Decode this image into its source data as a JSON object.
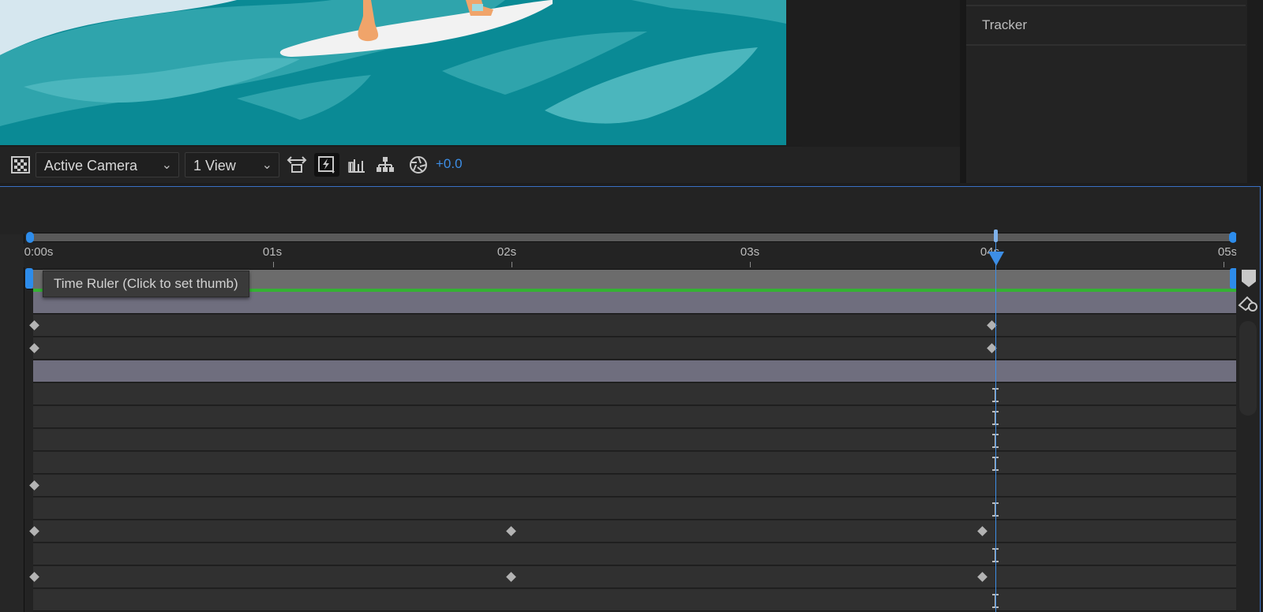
{
  "right_panel": {
    "tracker_label": "Tracker"
  },
  "viewer_toolbar": {
    "camera_dropdown": "Active Camera",
    "view_dropdown": "1 View",
    "exposure_value": "+0.0",
    "icons": [
      "transparency-grid-icon",
      "toggle-3d-icon",
      "fast-preview-icon",
      "draft-3d-icon",
      "flowchart-icon",
      "reset-exposure-icon"
    ]
  },
  "timeline": {
    "ruler_labels": [
      "0:00s",
      "01s",
      "02s",
      "03s",
      "04s",
      "05s"
    ],
    "tooltip": "Time Ruler (Click to set thumb)",
    "current_time_seconds": 4.0
  },
  "colors": {
    "accent_blue": "#3d8ee6",
    "work_area_green": "#34b233",
    "layer_bar": "#6f6e7e",
    "wave_teal": "#0a8a95"
  }
}
